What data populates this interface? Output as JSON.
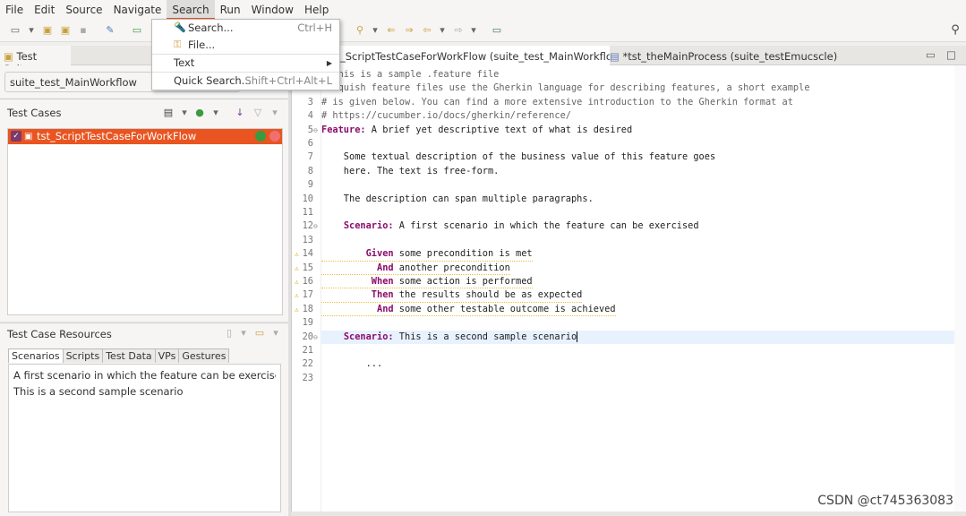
{
  "menubar": {
    "items": [
      "File",
      "Edit",
      "Source",
      "Navigate",
      "Search",
      "Run",
      "Window",
      "Help"
    ],
    "active": "Search"
  },
  "search_menu": {
    "items": [
      {
        "label": "Search...",
        "shortcut": "Ctrl+H",
        "icon": "search-flashlight-icon"
      },
      {
        "label": "File...",
        "shortcut": "",
        "icon": "file-search-icon"
      },
      {
        "label": "Text",
        "shortcut": "",
        "submenu": true
      },
      {
        "label": "Quick Search...",
        "shortcut": "Shift+Ctrl+Alt+L"
      }
    ]
  },
  "left": {
    "suites_tab": "Test Suites",
    "suite_combo": "suite_test_MainWorkflow",
    "test_cases_title": "Test Cases",
    "test_cases": [
      {
        "name": "tst_ScriptTestCaseForWorkFlow",
        "selected": true
      }
    ],
    "resources_title": "Test Case Resources",
    "resource_tabs": [
      "Scenarios",
      "Scripts",
      "Test Data",
      "VPs",
      "Gestures"
    ],
    "active_resource_tab": "Scenarios",
    "scenarios": [
      "A first scenario in which the feature can be exercised",
      "This is a second sample scenario"
    ]
  },
  "editor": {
    "tabs": [
      {
        "label": "tst_ScriptTestCaseForWorkFlow (suite_test_MainWorkflow)",
        "active": true,
        "close": "×"
      },
      {
        "label": "*tst_theMainProcess (suite_testEmucscle)",
        "active": false
      }
    ],
    "lines": [
      {
        "n": "1",
        "parts": [
          {
            "t": "# This is a sample .feature file",
            "c": "cm"
          }
        ]
      },
      {
        "n": "2",
        "parts": [
          {
            "t": "# Squish feature files use the Gherkin language for describing features, a short example",
            "c": "cm"
          }
        ]
      },
      {
        "n": "3",
        "parts": [
          {
            "t": "# is given below. You can find a more extensive introduction to the Gherkin format at",
            "c": "cm"
          }
        ]
      },
      {
        "n": "4",
        "parts": [
          {
            "t": "# https://cucumber.io/docs/gherkin/reference/",
            "c": "cm"
          }
        ]
      },
      {
        "n": "5",
        "fold": true,
        "parts": [
          {
            "t": "Feature:",
            "c": "kw"
          },
          {
            "t": " A brief yet descriptive text of what is desired"
          }
        ]
      },
      {
        "n": "6",
        "parts": []
      },
      {
        "n": "7",
        "parts": [
          {
            "t": "    Some textual description of the business value of this feature goes"
          }
        ]
      },
      {
        "n": "8",
        "parts": [
          {
            "t": "    here. The text is free-form."
          }
        ]
      },
      {
        "n": "9",
        "parts": []
      },
      {
        "n": "10",
        "parts": [
          {
            "t": "    The description can span multiple paragraphs."
          }
        ]
      },
      {
        "n": "11",
        "parts": []
      },
      {
        "n": "12",
        "fold": true,
        "parts": [
          {
            "t": "    "
          },
          {
            "t": "Scenario:",
            "c": "kw"
          },
          {
            "t": " A first scenario in which the feature can be exercised"
          }
        ]
      },
      {
        "n": "13",
        "parts": []
      },
      {
        "n": "14",
        "warn": true,
        "parts": [
          {
            "t": "        "
          },
          {
            "t": "Given",
            "c": "kw"
          },
          {
            "t": " some precondition is met"
          }
        ]
      },
      {
        "n": "15",
        "warn": true,
        "parts": [
          {
            "t": "          "
          },
          {
            "t": "And",
            "c": "kw"
          },
          {
            "t": " another precondition"
          }
        ]
      },
      {
        "n": "16",
        "warn": true,
        "parts": [
          {
            "t": "         "
          },
          {
            "t": "When",
            "c": "kw"
          },
          {
            "t": " some action is performed"
          }
        ]
      },
      {
        "n": "17",
        "warn": true,
        "parts": [
          {
            "t": "         "
          },
          {
            "t": "Then",
            "c": "kw"
          },
          {
            "t": " the results should be as expected"
          }
        ]
      },
      {
        "n": "18",
        "warn": true,
        "parts": [
          {
            "t": "          "
          },
          {
            "t": "And",
            "c": "kw"
          },
          {
            "t": " some other testable outcome is achieved"
          }
        ]
      },
      {
        "n": "19",
        "parts": []
      },
      {
        "n": "20",
        "fold": true,
        "current": true,
        "parts": [
          {
            "t": "    "
          },
          {
            "t": "Scenario:",
            "c": "kw"
          },
          {
            "t": " This is a second sample scenario"
          }
        ]
      },
      {
        "n": "21",
        "parts": []
      },
      {
        "n": "22",
        "parts": [
          {
            "t": "        ..."
          }
        ]
      },
      {
        "n": "23",
        "parts": []
      }
    ]
  },
  "watermark": "CSDN @ct745363083",
  "colors": {
    "accent": "#e95420",
    "keyword": "#8b0a6b",
    "current_line": "#e8f2fe"
  }
}
